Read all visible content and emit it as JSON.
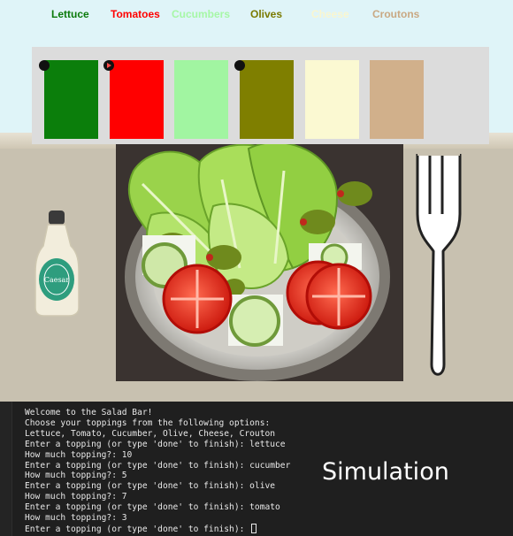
{
  "toppings": [
    {
      "label": "Lettuce",
      "color": "#0b7a0b"
    },
    {
      "label": "Tomatoes",
      "color": "#ff0000"
    },
    {
      "label": "Cucumbers",
      "color": "#a6f7a6"
    },
    {
      "label": "Olives",
      "color": "#7a7a00"
    },
    {
      "label": "Cheese",
      "color": "#f9f6d0"
    },
    {
      "label": "Croutons",
      "color": "#c9a883"
    }
  ],
  "swatches": [
    {
      "topping": "Lettuce",
      "color": "#0b7e0b",
      "handle": "dot"
    },
    {
      "topping": "Tomatoes",
      "color": "#ff0000",
      "handle": "arrow-dot"
    },
    {
      "topping": "Cucumbers",
      "color": "#a1f5a1",
      "handle": "none"
    },
    {
      "topping": "Olives",
      "color": "#7f7f00",
      "handle": "dot"
    },
    {
      "topping": "Cheese",
      "color": "#fbf9d2",
      "handle": "none"
    },
    {
      "topping": "Croutons",
      "color": "#d1b08b",
      "handle": "none"
    }
  ],
  "dressing_label": "Caesar",
  "terminal": {
    "lines": [
      "Welcome to the Salad Bar!",
      "Choose your toppings from the following options:",
      "Lettuce, Tomato, Cucumber, Olive, Cheese, Crouton",
      "Enter a topping (or type 'done' to finish): lettuce",
      "How much topping?: 10",
      "Enter a topping (or type 'done' to finish): cucumber",
      "How much topping?: 5",
      "Enter a topping (or type 'done' to finish): olive",
      "How much topping?: 7",
      "Enter a topping (or type 'done' to finish): tomato",
      "How much topping?: 3",
      "Enter a topping (or type 'done' to finish): "
    ]
  },
  "overlay_title": "Simulation"
}
